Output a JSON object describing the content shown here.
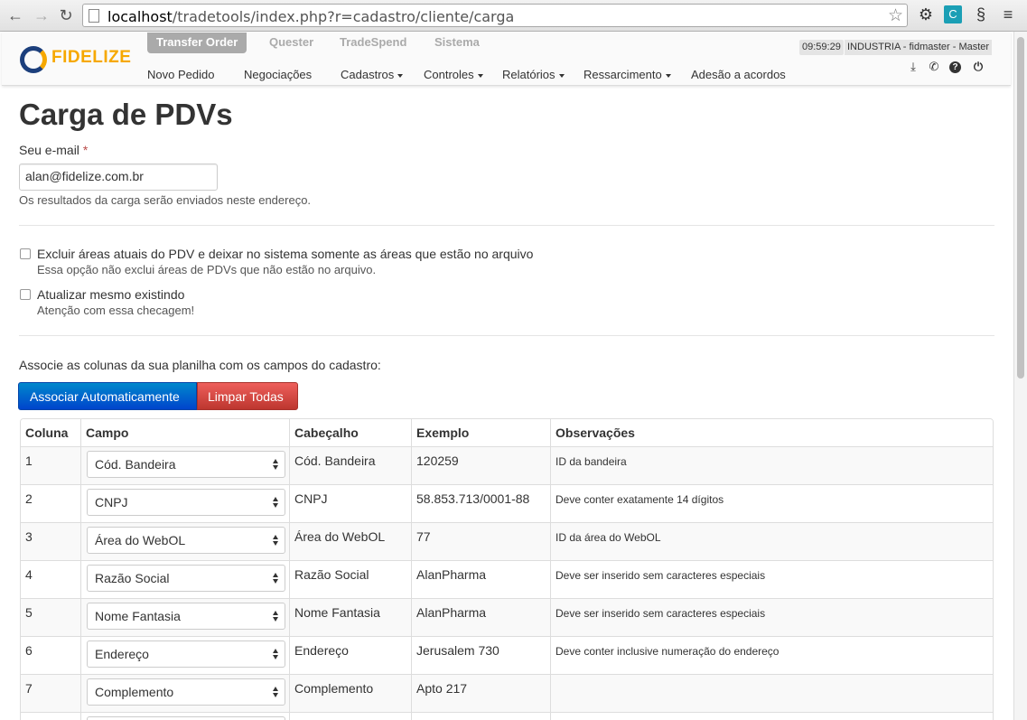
{
  "browser": {
    "url_host": "localhost",
    "url_path": "/tradetools/index.php?r=cadastro/cliente/carga"
  },
  "app": {
    "logo_text": "FIDELIZE",
    "modules": [
      "Transfer Order",
      "Quester",
      "TradeSpend",
      "Sistema"
    ],
    "active_module": "Transfer Order",
    "menu": [
      {
        "label": "Novo Pedido",
        "dropdown": false
      },
      {
        "label": "Negociações",
        "dropdown": false
      },
      {
        "label": "Cadastros",
        "dropdown": true
      },
      {
        "label": "Controles",
        "dropdown": true
      },
      {
        "label": "Relatórios",
        "dropdown": true
      },
      {
        "label": "Ressarcimento",
        "dropdown": true
      },
      {
        "label": "Adesão a acordos",
        "dropdown": false
      }
    ],
    "clock": "09:59:29",
    "user_info": "INDUSTRIA - fidmaster - Master"
  },
  "page": {
    "title": "Carga de PDVs",
    "email_label": "Seu e-mail",
    "required_mark": "*",
    "email_value": "alan@fidelize.com.br",
    "email_help": "Os resultados da carga serão enviados neste endereço.",
    "options": [
      {
        "label": "Excluir áreas atuais do PDV e deixar no sistema somente as áreas que estão no arquivo",
        "help": "Essa opção não exclui áreas de PDVs que não estão no arquivo.",
        "checked": false
      },
      {
        "label": "Atualizar mesmo existindo",
        "help": "Atenção com essa checagem!",
        "checked": false
      }
    ],
    "associate_text": "Associe as colunas da sua planilha com os campos do cadastro:",
    "btn_auto": "Associar Automaticamente",
    "btn_clear": "Limpar Todas"
  },
  "table": {
    "headers": [
      "Coluna",
      "Campo",
      "Cabeçalho",
      "Exemplo",
      "Observações"
    ],
    "rows": [
      {
        "coluna": "1",
        "campo": "Cód. Bandeira",
        "cabecalho": "Cód. Bandeira",
        "exemplo": "120259",
        "obs": "ID da bandeira"
      },
      {
        "coluna": "2",
        "campo": "CNPJ",
        "cabecalho": "CNPJ",
        "exemplo": "58.853.713/0001-88",
        "obs": "Deve conter exatamente 14 dígitos"
      },
      {
        "coluna": "3",
        "campo": "Área do WebOL",
        "cabecalho": "Área do WebOL",
        "exemplo": "77",
        "obs": "ID da área do WebOL"
      },
      {
        "coluna": "4",
        "campo": "Razão Social",
        "cabecalho": "Razão Social",
        "exemplo": "AlanPharma",
        "obs": "Deve ser inserido sem caracteres especiais"
      },
      {
        "coluna": "5",
        "campo": "Nome Fantasia",
        "cabecalho": "Nome Fantasia",
        "exemplo": "AlanPharma",
        "obs": "Deve ser inserido sem caracteres especiais"
      },
      {
        "coluna": "6",
        "campo": "Endereço",
        "cabecalho": "Endereço",
        "exemplo": "Jerusalem 730",
        "obs": "Deve conter inclusive numeração do endereço"
      },
      {
        "coluna": "7",
        "campo": "Complemento",
        "cabecalho": "Complemento",
        "exemplo": "Apto 217",
        "obs": ""
      }
    ]
  },
  "colors": {
    "brand_orange": "#f6a800",
    "brand_blue": "#1c3f7c",
    "primary": "#0055cc",
    "danger": "#bd362f"
  }
}
